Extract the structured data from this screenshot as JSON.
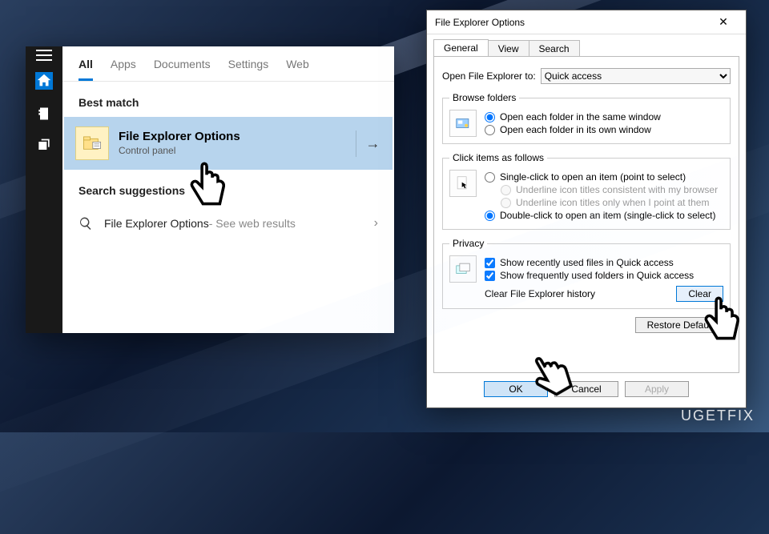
{
  "search": {
    "tabs": [
      "All",
      "Apps",
      "Documents",
      "Settings",
      "Web"
    ],
    "active_tab": 0,
    "best_match_heading": "Best match",
    "result": {
      "title": "File Explorer Options",
      "subtitle": "Control panel"
    },
    "suggestions_heading": "Search suggestions",
    "suggestion_text": "File Explorer Options",
    "suggestion_suffix": " - See web results"
  },
  "dialog": {
    "title": "File Explorer Options",
    "tabs": [
      "General",
      "View",
      "Search"
    ],
    "active_tab": 0,
    "open_to_label": "Open File Explorer to:",
    "open_to_value": "Quick access",
    "browse_legend": "Browse folders",
    "browse_opts": {
      "same": "Open each folder in the same window",
      "own": "Open each folder in its own window"
    },
    "click_legend": "Click items as follows",
    "click_opts": {
      "single": "Single-click to open an item (point to select)",
      "underline_browser": "Underline icon titles consistent with my browser",
      "underline_point": "Underline icon titles only when I point at them",
      "double": "Double-click to open an item (single-click to select)"
    },
    "privacy_legend": "Privacy",
    "privacy_opts": {
      "recent": "Show recently used files in Quick access",
      "freq": "Show frequently used folders in Quick access"
    },
    "clear_label": "Clear File Explorer history",
    "clear_button": "Clear",
    "restore_button": "Restore Defaults",
    "ok": "OK",
    "cancel": "Cancel",
    "apply": "Apply"
  },
  "watermark": "UGETFIX"
}
